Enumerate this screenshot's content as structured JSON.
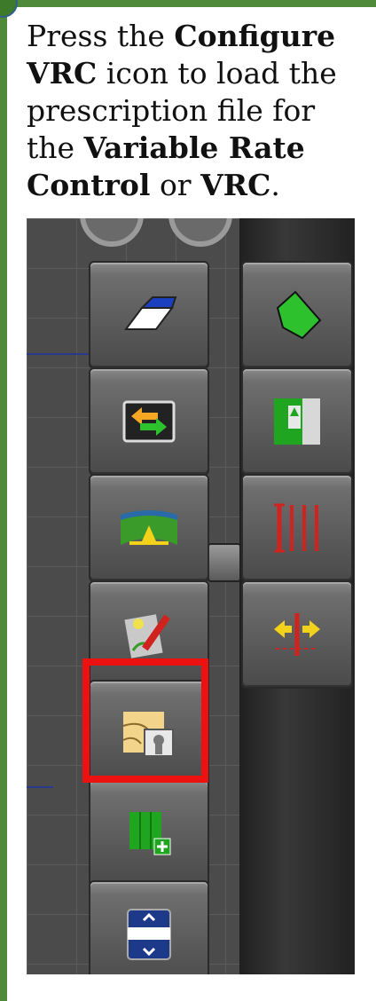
{
  "instruction": {
    "t1": "Press the ",
    "b1": "Configure VRC",
    "t2": " icon to load the prescription file for the ",
    "b2": "Variable Rate Control",
    "t3": " or ",
    "b3": "VRC",
    "t4": "."
  },
  "left_toolbar": [
    {
      "icon": "eraser-icon"
    },
    {
      "icon": "swap-arrows-icon"
    },
    {
      "icon": "field-guidance-icon"
    },
    {
      "icon": "edit-map-pencil-icon"
    },
    {
      "icon": "configure-vrc-icon",
      "highlighted": true
    },
    {
      "icon": "add-field-icon"
    },
    {
      "icon": "scroll-menu-icon"
    }
  ],
  "right_toolbar": [
    {
      "icon": "field-boundary-icon"
    },
    {
      "icon": "headland-icon"
    },
    {
      "icon": "guidance-lines-icon"
    },
    {
      "icon": "nudge-icon"
    }
  ],
  "colors": {
    "highlight": "#ee1111",
    "frame": "#4f8a3a",
    "icon_green": "#1fa51f"
  }
}
